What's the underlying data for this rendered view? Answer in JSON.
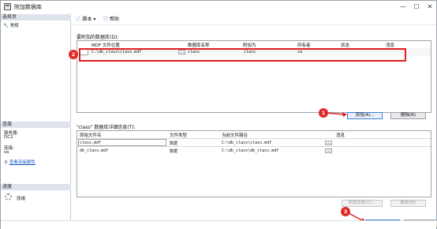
{
  "window": {
    "title": "附加数据库"
  },
  "left": {
    "select_page_header": "选择页",
    "nav_general": "常规",
    "connection_header": "连接",
    "server_label": "服务器:",
    "server_value": "DC2",
    "conn_label": "连接:",
    "conn_value": "sa",
    "view_conn_props": "查看连接属性",
    "progress_header": "进度",
    "progress_status": "就绪"
  },
  "toolbar": {
    "script_label": "脚本",
    "help_label": "帮助"
  },
  "attach_section": {
    "title": "要附加的数据库(D):",
    "columns": [
      "MDF 文件位置",
      "数据库名称",
      "附加为",
      "所有者",
      "状态",
      "消息"
    ],
    "row": {
      "path": "C:\\db_class\\class.mdf",
      "db_name": "class",
      "attach_as": "class",
      "owner": "sa",
      "status": "",
      "message": ""
    },
    "add_button": "添加(A)...",
    "remove_button": "删除(R)"
  },
  "detail_section": {
    "title": "\"class\" 数据库详细信息(T):",
    "columns": [
      "原始文件名",
      "文件类型",
      "当前文件路径",
      "消息"
    ],
    "rows": [
      {
        "name": "class.mdf",
        "type": "数据",
        "path": "C:\\db_class\\class.mdf",
        "message": ""
      },
      {
        "name": "db_class.mdf",
        "type": "数据",
        "path": "C:\\db_class\\db_class.mdf",
        "message": ""
      }
    ],
    "add_catalog_button": "添加目录(C)...",
    "remove_button": "删除(M)"
  },
  "footer": {
    "ok_button": "确定",
    "cancel_button": "取消"
  },
  "callouts": {
    "c1": "1",
    "c2": "2",
    "c3": "3"
  },
  "colors": {
    "highlight_red": "#e11f1f",
    "accent_blue": "#1a57c9"
  }
}
